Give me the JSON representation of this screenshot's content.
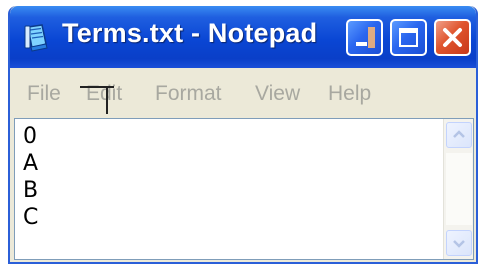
{
  "window": {
    "title": "Terms.txt - Notepad",
    "app_icon": "notepad-icon",
    "controls": {
      "minimize_icon": "minimize-icon",
      "maximize_icon": "maximize-icon",
      "close_icon": "close-icon"
    }
  },
  "menu": {
    "file": "File",
    "edit": "Edit",
    "format": "Format",
    "view": "View",
    "help": "Help"
  },
  "editor": {
    "lines": [
      "0",
      "A",
      "B",
      "C"
    ]
  },
  "scrollbar": {
    "up_icon": "scroll-up-arrow-icon",
    "down_icon": "scroll-down-arrow-icon"
  },
  "colors": {
    "titlebar": "#0a46d4",
    "close_button": "#e0552e",
    "menu_text_disabled": "#a8a8a0",
    "window_face": "#ece9d8"
  }
}
